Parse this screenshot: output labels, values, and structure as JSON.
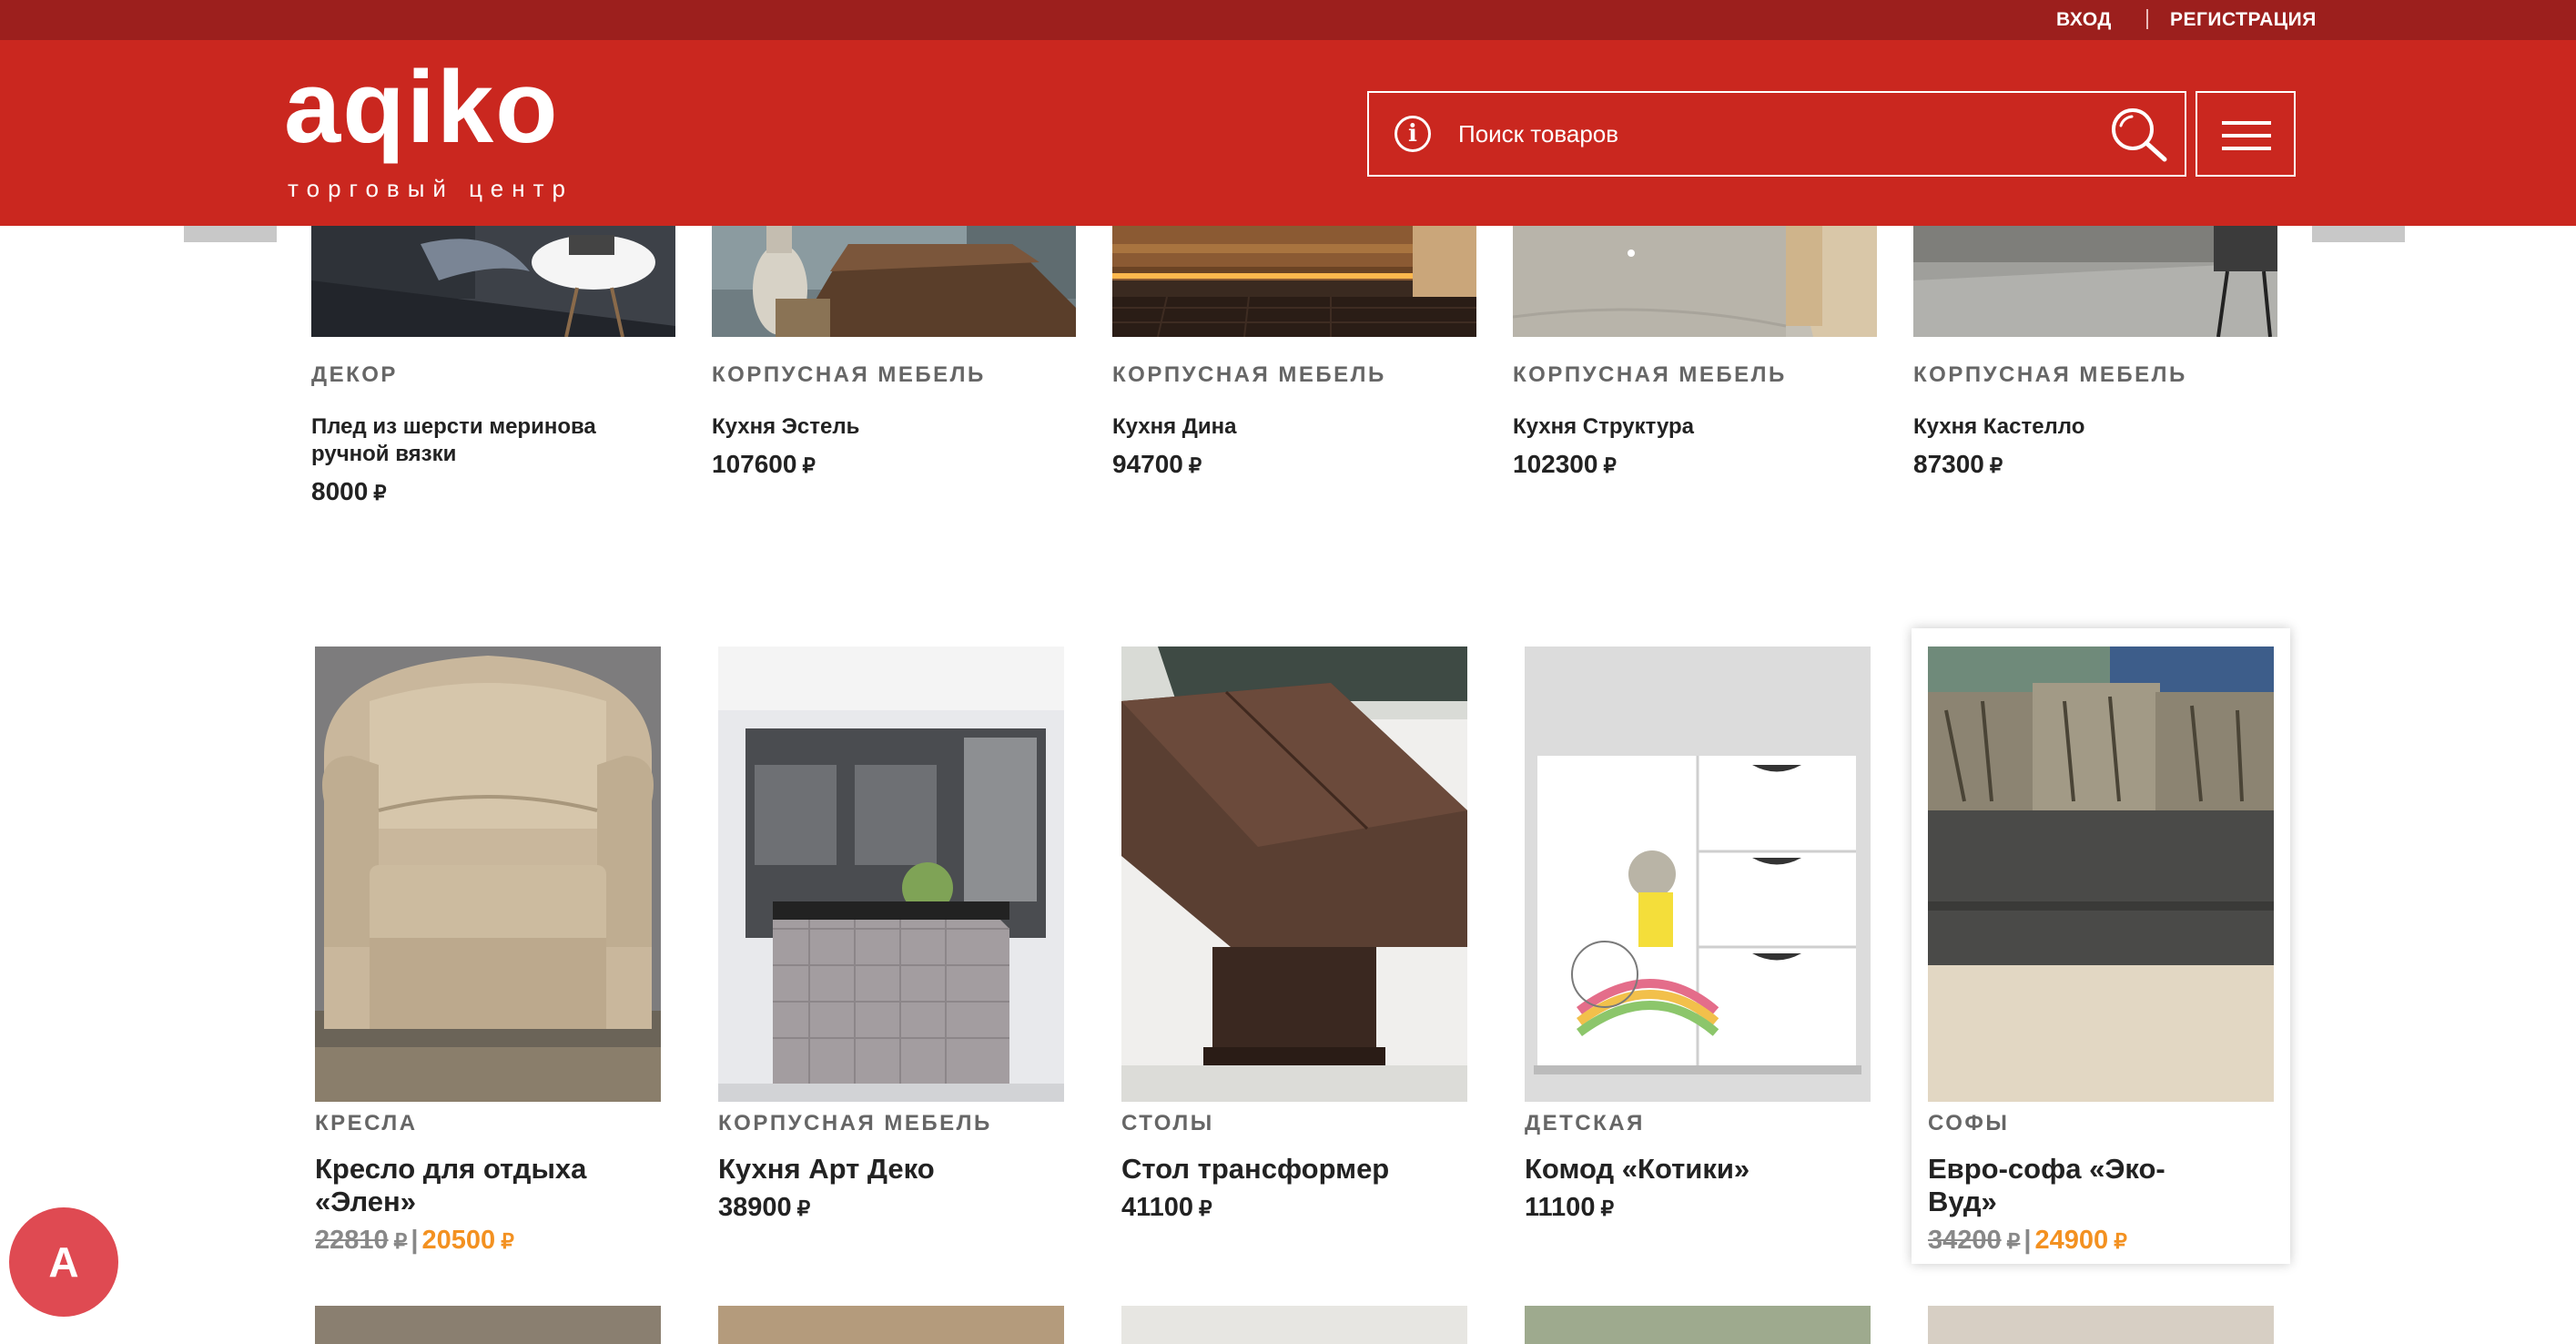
{
  "auth": {
    "login": "ВХОД",
    "register": "РЕГИСТРАЦИЯ"
  },
  "logo": {
    "name": "aqiko",
    "subtitle": "торговый центр"
  },
  "search": {
    "placeholder": "Поиск товаров"
  },
  "currency": "₽",
  "carousel_products": [
    {
      "category": "ДЕКОР",
      "name": "Плед из шерсти меринова ручной вязки",
      "price": "8000"
    },
    {
      "category": "КОРПУСНАЯ МЕБЕЛЬ",
      "name": "Кухня Эстель",
      "price": "107600"
    },
    {
      "category": "КОРПУСНАЯ МЕБЕЛЬ",
      "name": "Кухня Дина",
      "price": "94700"
    },
    {
      "category": "КОРПУСНАЯ МЕБЕЛЬ",
      "name": "Кухня Структура",
      "price": "102300"
    },
    {
      "category": "КОРПУСНАЯ МЕБЕЛЬ",
      "name": "Кухня Кастелло",
      "price": "87300"
    }
  ],
  "grid_products": [
    {
      "category": "КРЕСЛА",
      "name": "Кресло для отдыха «Элен»",
      "old_price": "22810",
      "price": "20500"
    },
    {
      "category": "КОРПУСНАЯ МЕБЕЛЬ",
      "name": "Кухня Арт Деко",
      "price": "38900"
    },
    {
      "category": "СТОЛЫ",
      "name": "Стол трансформер",
      "price": "41100"
    },
    {
      "category": "ДЕТСКАЯ",
      "name": "Комод «Котики»",
      "price": "11100"
    },
    {
      "category": "СОФЫ",
      "name": "Евро-софа «Эко-Вуд»",
      "old_price": "34200",
      "price": "24900"
    }
  ],
  "user": {
    "initial": "A"
  },
  "colors": {
    "header": "#ca271f",
    "topbar": "#9c1f1d",
    "sale_price": "#f39121",
    "avatar": "#df4a52"
  }
}
